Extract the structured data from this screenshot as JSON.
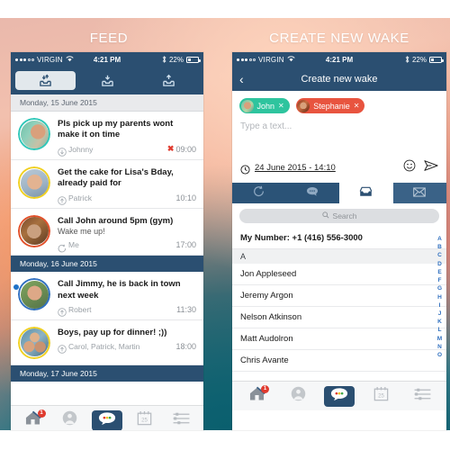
{
  "panels": {
    "left_title": "FEED",
    "right_title": "CREATE NEW WAKE"
  },
  "colors": {
    "navy": "#2b4f71",
    "teal_chip": "#2ec49e",
    "red_chip": "#e8543f",
    "accent_red": "#e03b2f",
    "unread_blue": "#1f72c7",
    "alpha_blue": "#2f6fbf",
    "bg_top": "#f2c0ae",
    "bg_bottom": "#0d5f70"
  },
  "status_bar": {
    "carrier": "VIRGIN",
    "wifi_icon": "wifi-icon",
    "time": "4:21 PM",
    "bluetooth_icon": "bluetooth-icon",
    "battery_pct": "22%",
    "signal_filled_dots": 3,
    "signal_empty_dots": 2
  },
  "feed_screen": {
    "segments": [
      {
        "icon": "inbox-download-icon",
        "selected": true
      },
      {
        "icon": "download-tray-icon",
        "selected": false
      },
      {
        "icon": "upload-tray-icon",
        "selected": false
      }
    ],
    "sections": [
      {
        "day_label": "Monday, 15 June 2015",
        "style": "grey",
        "items": [
          {
            "title": "Pls pick up my parents wont make it on time",
            "sub": "",
            "sender": "Johnny",
            "sender_icon": "arrow-down-circle-icon",
            "time": "09:00",
            "failed": true,
            "fail_mark": "✖",
            "unread": false,
            "ring_color": "#2ec7b8",
            "avatar": "avatar-johnny"
          },
          {
            "title": "Get the cake for Lisa's Bday, already paid for",
            "sub": "",
            "sender": "Patrick",
            "sender_icon": "arrow-up-circle-icon",
            "time": "10:10",
            "failed": false,
            "fail_mark": "",
            "unread": false,
            "ring_color": "#f0d020",
            "avatar": "avatar-patrick"
          },
          {
            "title": "Call John around 5pm (gym)",
            "sub": "Wake me up!",
            "sender": "Me",
            "sender_icon": "refresh-circle-icon",
            "time": "17:00",
            "failed": false,
            "fail_mark": "",
            "unread": false,
            "ring_color": "#e2502a",
            "avatar": "avatar-me"
          }
        ]
      },
      {
        "day_label": "Monday, 16 June 2015",
        "style": "blue",
        "items": [
          {
            "title": "Call Jimmy, he is back in town next week",
            "sub": "",
            "sender": "Robert",
            "sender_icon": "arrow-up-circle-icon",
            "time": "11:30",
            "failed": false,
            "fail_mark": "",
            "unread": true,
            "ring_color": "#2f6fbf",
            "avatar": "avatar-robert"
          },
          {
            "title": "Boys, pay up for dinner! ;))",
            "sub": "",
            "sender": "Carol, Patrick, Martin",
            "sender_icon": "arrow-up-circle-icon",
            "time": "18:00",
            "failed": false,
            "fail_mark": "",
            "unread": false,
            "ring_color": "#f0d020",
            "avatar": "avatar-group"
          }
        ]
      },
      {
        "day_label": "Monday, 17 June 2015",
        "style": "blue",
        "items": []
      }
    ]
  },
  "wake_screen": {
    "back_icon": "chevron-left-icon",
    "title": "Create new wake",
    "recipients": [
      {
        "name": "John",
        "color": "#2ec49e",
        "remove_icon": "close-x-icon",
        "avatar": "avatar-john"
      },
      {
        "name": "Stephanie",
        "color": "#e8543f",
        "remove_icon": "close-x-icon",
        "avatar": "avatar-stephanie"
      }
    ],
    "message_placeholder": "Type a text...",
    "schedule": {
      "clock_icon": "clock-icon",
      "value": "24 June 2015 - 14:10",
      "emoji_icon": "smiley-icon",
      "send_icon": "send-paperplane-icon"
    },
    "mode_tabs": [
      {
        "icon": "refresh-icon",
        "state": "normal"
      },
      {
        "icon": "chat-bubble-icon",
        "state": "normal"
      },
      {
        "icon": "inbox-tray-icon",
        "state": "selected"
      },
      {
        "icon": "envelope-icon",
        "state": "dim"
      }
    ],
    "search": {
      "icon": "search-icon",
      "placeholder": "Search"
    },
    "my_number_label": "My Number: +1 (416) 556-3000",
    "section_letter": "A",
    "contacts": [
      "Jon Appleseed",
      "Jeremy Argon",
      "Nelson Atkinson",
      "Matt Audolron",
      "Chris Avante"
    ],
    "alpha_index": [
      "A",
      "B",
      "C",
      "D",
      "E",
      "F",
      "G",
      "H",
      "I",
      "J",
      "K",
      "L",
      "M",
      "N",
      "O"
    ]
  },
  "tabbar": {
    "tabs": [
      {
        "icon": "home-icon",
        "badge": "1",
        "active": false
      },
      {
        "icon": "profile-icon",
        "badge": "",
        "active": false
      },
      {
        "icon": "chat-bubble-icon",
        "badge": "",
        "active": true
      },
      {
        "icon": "calendar-icon",
        "badge": "",
        "active": false,
        "calendar_day": "25"
      },
      {
        "icon": "list-icon",
        "badge": "",
        "active": false
      }
    ]
  }
}
